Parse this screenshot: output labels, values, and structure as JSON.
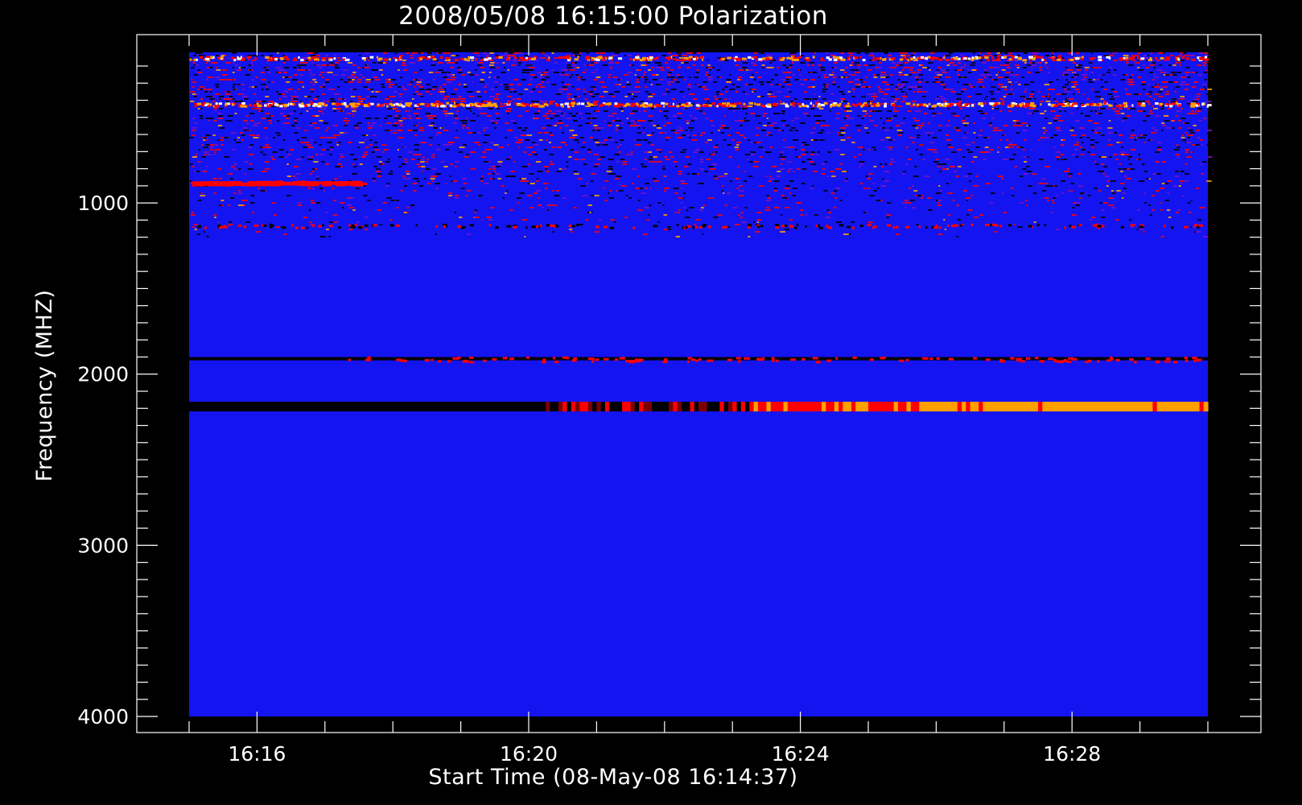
{
  "chart_data": {
    "type": "heatmap",
    "title": "2008/05/08 16:15:00 Polarization",
    "xlabel": "Start Time (08-May-08 16:14:37)",
    "ylabel": "Frequency (MHZ)",
    "x_range": [
      "16:15:00",
      "16:30:00"
    ],
    "y_range": [
      120,
      4000
    ],
    "y_reversed": true,
    "x_ticks": [
      {
        "value": "16:16",
        "label": "16:16"
      },
      {
        "value": "16:20",
        "label": "16:20"
      },
      {
        "value": "16:24",
        "label": "16:24"
      },
      {
        "value": "16:28",
        "label": "16:28"
      }
    ],
    "y_ticks": [
      {
        "value": 1000,
        "label": "1000"
      },
      {
        "value": 2000,
        "label": "2000"
      },
      {
        "value": 3000,
        "label": "3000"
      },
      {
        "value": 4000,
        "label": "4000"
      }
    ],
    "x_minor_step_minutes": 1,
    "y_minor_step": 100,
    "colormap": [
      "#000000",
      "#1010ff",
      "#ff0000",
      "#ffa000",
      "#ffffff"
    ],
    "background_color": "#1414f0",
    "bands": [
      {
        "freq": 150,
        "intensity": "noisy",
        "start": "16:15:00",
        "end": "16:30:00"
      },
      {
        "freq": 420,
        "intensity": "bright",
        "start": "16:15:00",
        "end": "16:30:00"
      },
      {
        "freq": 880,
        "intensity": "red",
        "start": "16:15:00",
        "end": "16:17:30"
      },
      {
        "freq": 1130,
        "intensity": "dotted",
        "start": "16:15:00",
        "end": "16:30:00"
      },
      {
        "freq": 1910,
        "intensity": "dark-to-red",
        "start": "16:15:00",
        "end": "16:30:00"
      },
      {
        "freq": 2190,
        "intensity": "dark-to-yellow",
        "start": "16:15:00",
        "end": "16:30:00"
      }
    ]
  }
}
